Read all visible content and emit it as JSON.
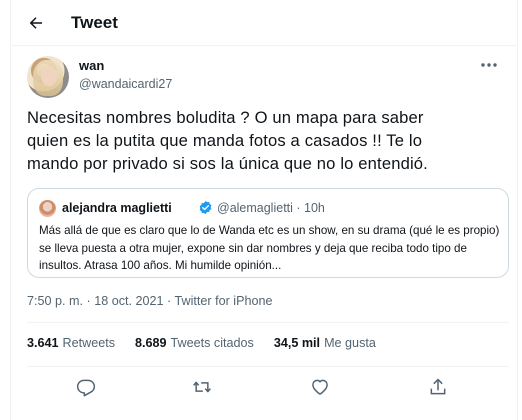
{
  "header": {
    "title": "Tweet"
  },
  "author": {
    "name": "wan",
    "handle": "@wandaicardi27"
  },
  "tweet": {
    "text": "Necesitas nombres boludita ? O un mapa para saber\nquien es la putita que manda fotos a casados !! Te lo\nmando por privado  si sos la única que no lo entendió."
  },
  "quote": {
    "name": "alejandra maglietti",
    "handle": "@alemaglietti · 10h",
    "text": "Más allá de que es claro que lo de Wanda etc es un show, en su drama (qué le es propio) se lleva puesta a otra mujer, expone sin dar nombres y deja que reciba todo tipo de insultos. Atrasa 100 años. Mi humilde opinión..."
  },
  "meta": {
    "time": "7:50 p. m. · 18 oct. 2021 · ",
    "source": "Twitter for iPhone"
  },
  "stats": [
    {
      "num": "3.641",
      "label": "Retweets"
    },
    {
      "num": "8.689",
      "label": "Tweets citados"
    },
    {
      "num": "34,5 mil",
      "label": "Me gusta"
    }
  ],
  "icons": {
    "back": "arrow-left-icon",
    "more": "more-dots-icon",
    "verified": "verified-badge-icon",
    "reply": "reply-icon",
    "retweet": "retweet-icon",
    "like": "heart-icon",
    "share": "share-icon"
  },
  "colors": {
    "text": "#0f1419",
    "secondary": "#536471",
    "verified": "#1d9bf0",
    "border": "#cfd9de"
  }
}
